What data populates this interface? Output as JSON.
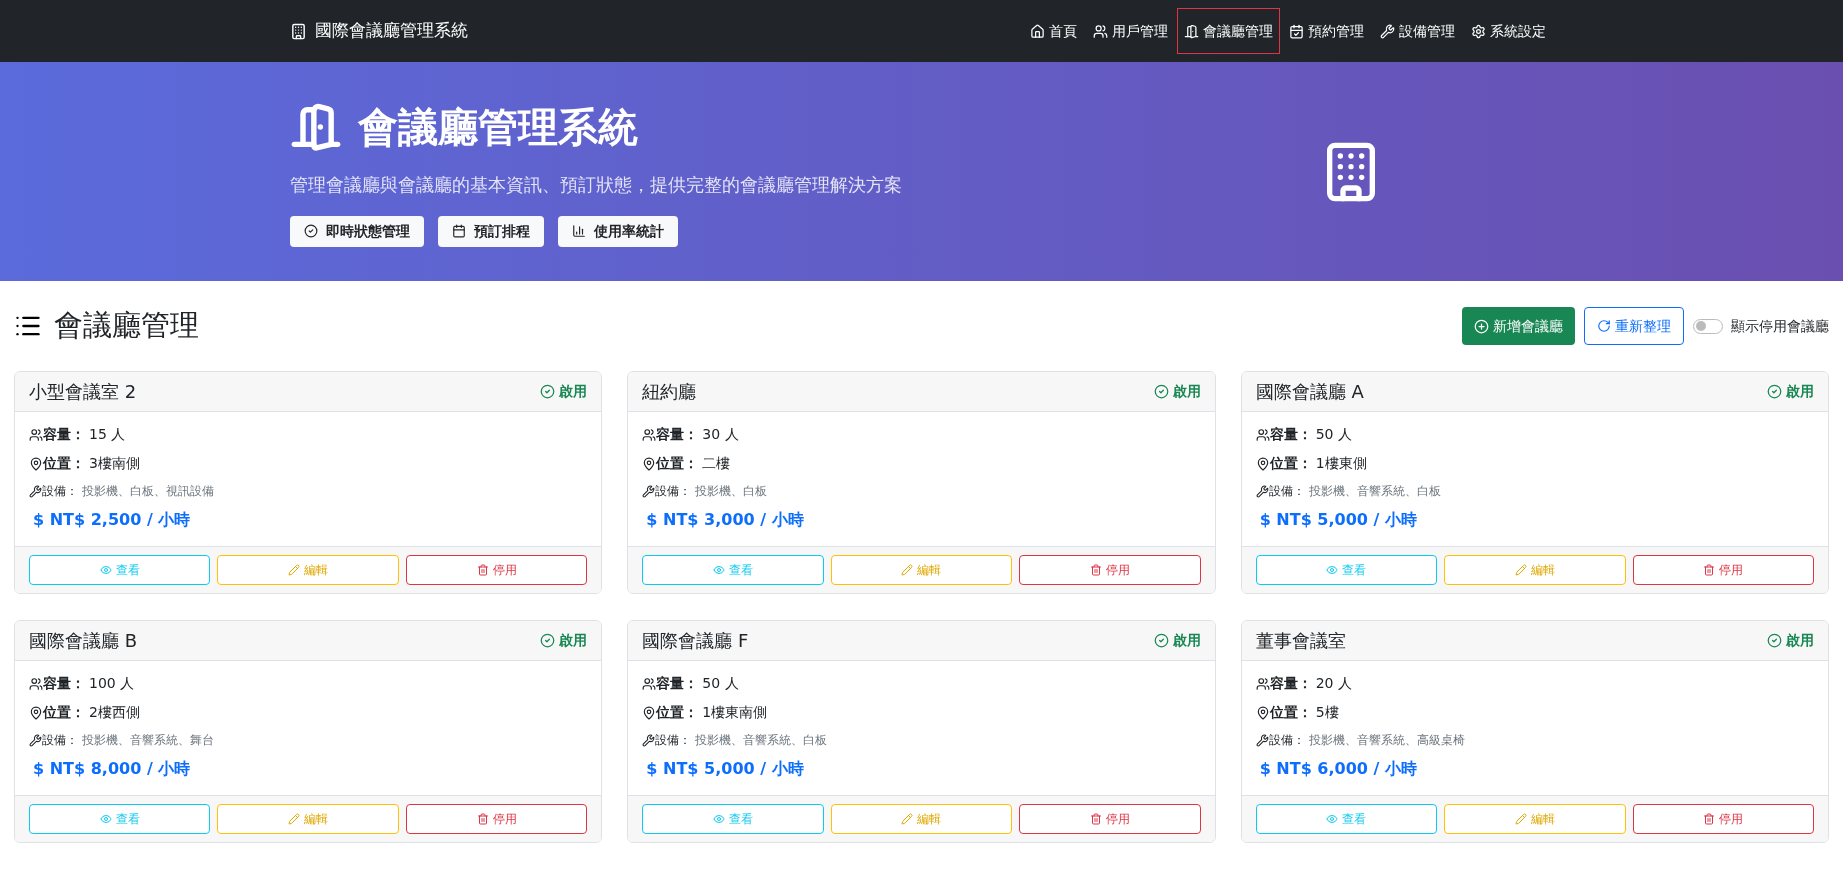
{
  "navbar": {
    "brand": "國際會議廳管理系統",
    "items": [
      {
        "label": "首頁",
        "selected": false
      },
      {
        "label": "用戶管理",
        "selected": false
      },
      {
        "label": "會議廳管理",
        "selected": true
      },
      {
        "label": "預約管理",
        "selected": false
      },
      {
        "label": "設備管理",
        "selected": false
      },
      {
        "label": "系統設定",
        "selected": false
      }
    ]
  },
  "hero": {
    "title": "會議廳管理系統",
    "subtitle": "管理會議廳與會議廳的基本資訊、預訂狀態，提供完整的會議廳管理解決方案",
    "features": [
      {
        "label": "即時狀態管理"
      },
      {
        "label": "預訂排程"
      },
      {
        "label": "使用率統計"
      }
    ]
  },
  "section": {
    "title": "會議廳管理",
    "add_button": "新增會議廳",
    "refresh_button": "重新整理",
    "show_disabled": {
      "label": "顯示停用會議廳",
      "on": false
    }
  },
  "halls": [
    {
      "name": "小型會議室 2",
      "status": "啟用",
      "enabled": true,
      "capacity_label": "容量：",
      "capacity": "15 人",
      "location_label": "位置：",
      "location": "3樓南側",
      "equipment_label": "設備：",
      "equipment": "投影機、白板、視訊設備",
      "price": "$ NT$ 2,500 / 小時",
      "actions": [
        "查看",
        "編輯",
        "停用"
      ]
    },
    {
      "name": "紐約廳",
      "status": "啟用",
      "enabled": true,
      "capacity_label": "容量：",
      "capacity": "30 人",
      "location_label": "位置：",
      "location": "二樓",
      "equipment_label": "設備：",
      "equipment": "投影機、白板",
      "price": "$ NT$ 3,000 / 小時",
      "actions": [
        "查看",
        "編輯",
        "停用"
      ]
    },
    {
      "name": "國際會議廳 A",
      "status": "啟用",
      "enabled": true,
      "capacity_label": "容量：",
      "capacity": "50 人",
      "location_label": "位置：",
      "location": "1樓東側",
      "equipment_label": "設備：",
      "equipment": "投影機、音響系統、白板",
      "price": "$ NT$ 5,000 / 小時",
      "actions": [
        "查看",
        "編輯",
        "停用"
      ]
    },
    {
      "name": "國際會議廳 B",
      "status": "啟用",
      "enabled": true,
      "capacity_label": "容量：",
      "capacity": "100 人",
      "location_label": "位置：",
      "location": "2樓西側",
      "equipment_label": "設備：",
      "equipment": "投影機、音響系統、舞台",
      "price": "$ NT$ 8,000 / 小時",
      "actions": [
        "查看",
        "編輯",
        "停用"
      ]
    },
    {
      "name": "國際會議廳 F",
      "status": "啟用",
      "enabled": true,
      "capacity_label": "容量：",
      "capacity": "50 人",
      "location_label": "位置：",
      "location": "1樓東南側",
      "equipment_label": "設備：",
      "equipment": "投影機、音響系統、白板",
      "price": "$ NT$ 5,000 / 小時",
      "actions": [
        "查看",
        "編輯",
        "停用"
      ]
    },
    {
      "name": "董事會議室",
      "status": "啟用",
      "enabled": true,
      "capacity_label": "容量：",
      "capacity": "20 人",
      "location_label": "位置：",
      "location": "5樓",
      "equipment_label": "設備：",
      "equipment": "投影機、音響系統、高級桌椅",
      "price": "$ NT$ 6,000 / 小時",
      "actions": [
        "查看",
        "編輯",
        "停用"
      ]
    }
  ]
}
